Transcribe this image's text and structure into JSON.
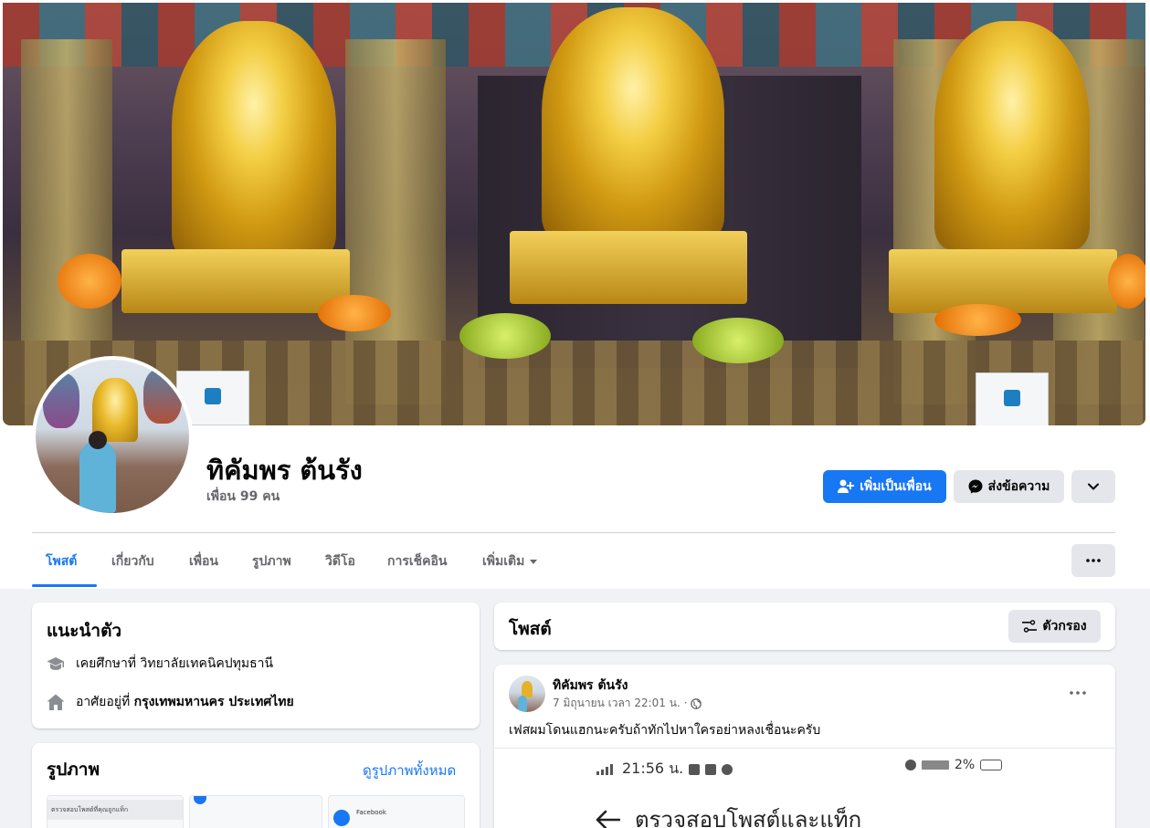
{
  "profile": {
    "name": "ทิคัมพร ต้นรัง",
    "friends_count": "เพื่อน 99 คน"
  },
  "actions": {
    "add_friend": "เพิ่มเป็นเพื่อน",
    "message": "ส่งข้อความ"
  },
  "tabs": [
    {
      "label": "โพสต์"
    },
    {
      "label": "เกี่ยวกับ"
    },
    {
      "label": "เพื่อน"
    },
    {
      "label": "รูปภาพ"
    },
    {
      "label": "วิดีโอ"
    },
    {
      "label": "การเช็คอิน"
    },
    {
      "label": "เพิ่มเติม"
    }
  ],
  "intro": {
    "title": "แนะนำตัว",
    "education_prefix": "เคยศึกษาที่",
    "education_value": "วิทยาลัยเทคนิคปทุมธานี",
    "lives_prefix": "อาศัยอยู่ที่",
    "lives_value": "กรุงเทพมหานคร ประเทศไทย"
  },
  "photos": {
    "title": "รูปภาพ",
    "see_all": "ดูรูปภาพทั้งหมด",
    "thumb1_text": "ตรวจสอบโพสต์ที่คุณถูกแท็ก",
    "thumb3_title": "Facebook"
  },
  "posts_header": {
    "title": "โพสต์",
    "filter": "ตัวกรอง"
  },
  "post": {
    "author": "ทิคัมพร ต้นรัง",
    "timestamp": "7 มิถุนายน เวลา 22:01 น. ·",
    "text": "เฟสผมโดนแฮกนะครับถ้าทักไปหาใครอย่าหลงเชื่อนะครับ",
    "screenshot_time": "21:56 น.",
    "screenshot_battery": "2%",
    "screenshot_title": "ตรวจสอบโพสต์และแท็ก"
  },
  "colors": {
    "accent": "#1877f2",
    "background": "#f0f2f5",
    "secondary_button": "#e4e6eb"
  }
}
